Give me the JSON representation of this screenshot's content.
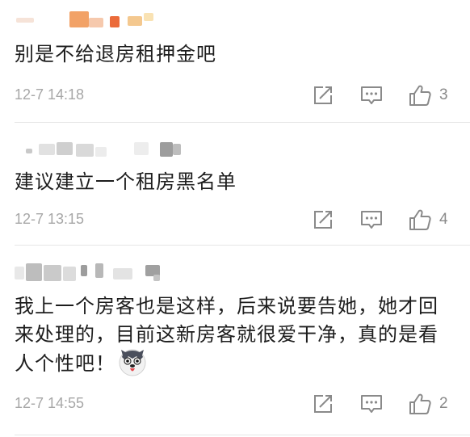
{
  "comments": [
    {
      "text": "别是不给退房租押金吧",
      "time": "12-7 14:18",
      "likes": "3"
    },
    {
      "text": "建议建立一个租房黑名单",
      "time": "12-7 13:15",
      "likes": "4"
    },
    {
      "text": "我上一个房客也是这样，后来说要告她，她才回来处理的，目前这新房客就很爱干净，真的是看人个性吧！",
      "time": "12-7 14:55",
      "likes": "2"
    }
  ],
  "icons": {
    "share": "share-icon",
    "reply": "comment-icon",
    "like": "thumbs-up-icon",
    "emoji": "husky-face-emoji"
  },
  "colors": {
    "time": "#a7a7a7",
    "icon": "#8a8a8a",
    "divider": "#e6e6e6"
  }
}
